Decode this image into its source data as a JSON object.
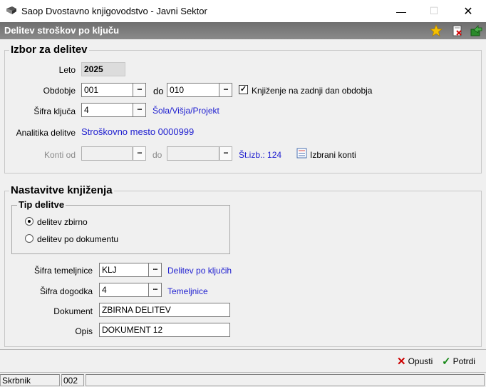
{
  "window": {
    "title": "Saop Dvostavno knjigovodstvo - Javni Sektor",
    "minimize": "—",
    "maximize": "☐",
    "close": "✕"
  },
  "header": {
    "title": "Delitev stroškov po ključu",
    "icons": [
      "star-icon",
      "delete-doc-icon",
      "export-icon"
    ]
  },
  "izbor": {
    "group_title": "Izbor za delitev",
    "leto_label": "Leto",
    "leto_value": "2025",
    "obdobje_label": "Obdobje",
    "obdobje_from": "001",
    "do_label": "do",
    "obdobje_to": "010",
    "zadnji_dan_label": "Knjiženje na zadnji dan obdobja",
    "zadnji_dan_checked": true,
    "sifra_kljuca_label": "Šifra ključa",
    "sifra_kljuca_value": "4",
    "sifra_kljuca_desc": "Šola/Višja/Projekt",
    "analitika_label": "Analitika delitve",
    "analitika_value": "Stroškovno mesto 0000999",
    "konti_od_label": "Konti od",
    "konti_od_value": "",
    "konti_do_label": "do",
    "konti_do_value": "",
    "st_izb": "Št.izb.: 124",
    "izbrani_konti": "Izbrani konti",
    "dots": "..."
  },
  "nastavitve": {
    "group_title": "Nastavitve knjiženja",
    "tip_title": "Tip delitve",
    "tip_options": [
      {
        "label": "delitev zbirno",
        "selected": true
      },
      {
        "label": "delitev po dokumentu",
        "selected": false
      }
    ],
    "temeljnica_label": "Šifra temeljnice",
    "temeljnica_value": "KLJ",
    "temeljnica_desc": "Delitev po ključih",
    "dogodek_label": "Šifra dogodka",
    "dogodek_value": "4",
    "dogodek_desc": "Temeljnice",
    "dokument_label": "Dokument",
    "dokument_value": "ZBIRNA DELITEV",
    "opis_label": "Opis",
    "opis_value": "DOKUMENT 12"
  },
  "buttons": {
    "cancel": "Opusti",
    "confirm": "Potrdi"
  },
  "status": {
    "user": "Skrbnik",
    "code": "002"
  },
  "colors": {
    "header_bg": "#7d7d7d",
    "link_blue": "#2020d0",
    "cancel_red": "#cc0000",
    "confirm_green": "#1a8a1a"
  }
}
